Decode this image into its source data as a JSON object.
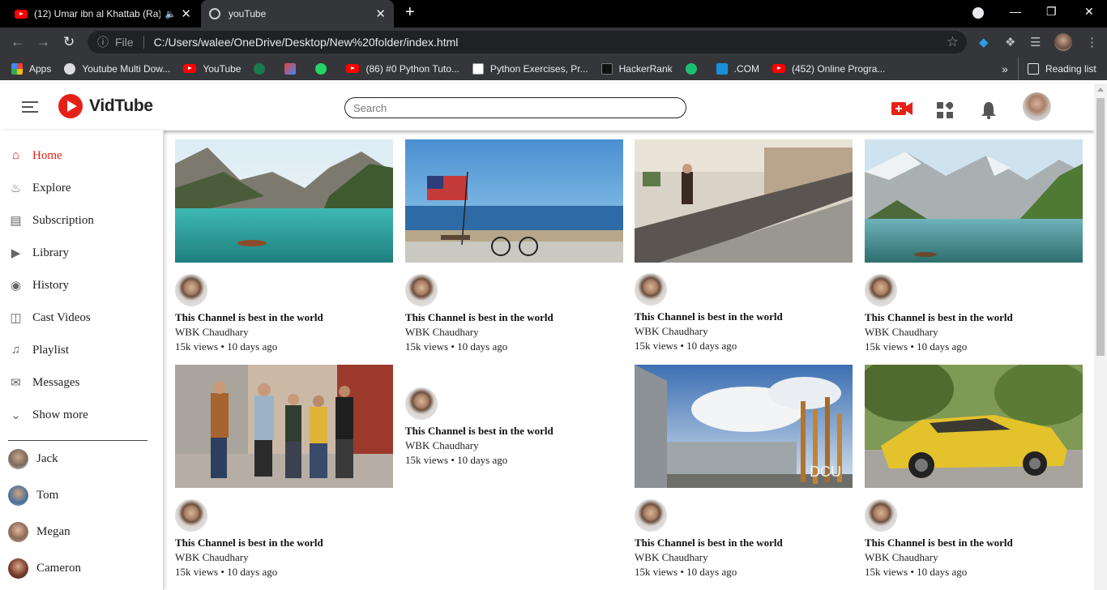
{
  "browser": {
    "tabs": [
      {
        "title": "(12) Umar ibn al Khattab (Ra)",
        "active": false,
        "icon": "youtube-icon"
      },
      {
        "title": "youTube",
        "active": true,
        "icon": "globe-icon"
      }
    ],
    "address": {
      "scheme_label": "File",
      "url": "C:/Users/walee/OneDrive/Desktop/New%20folder/index.html"
    },
    "bookmarks": [
      {
        "label": "Apps",
        "icon": "apps-grid-icon"
      },
      {
        "label": "Youtube Multi Dow...",
        "icon": "globe-icon"
      },
      {
        "label": "YouTube",
        "icon": "youtube-icon"
      },
      {
        "label": "",
        "icon": "drive-icon"
      },
      {
        "label": "",
        "icon": "gmail-icon"
      },
      {
        "label": "",
        "icon": "whatsapp-icon"
      },
      {
        "label": "(86) #0 Python Tuto...",
        "icon": "youtube-icon"
      },
      {
        "label": "Python Exercises, Pr...",
        "icon": "w3-icon"
      },
      {
        "label": "HackerRank",
        "icon": "hackerrank-icon"
      },
      {
        "label": "",
        "icon": "fiverr-icon"
      },
      {
        "label": ".COM",
        "icon": "play-icon"
      },
      {
        "label": "(452) Online Progra...",
        "icon": "youtube-icon"
      }
    ],
    "overflow_label": "»",
    "reading_list_label": "Reading list"
  },
  "header": {
    "logo_text": "VidTube",
    "search_placeholder": "Search",
    "accent_color": "#e62117"
  },
  "sidebar": {
    "items": [
      {
        "label": "Home",
        "icon": "home-icon",
        "active": true
      },
      {
        "label": "Explore",
        "icon": "fire-icon"
      },
      {
        "label": "Subscription",
        "icon": "subscription-icon"
      },
      {
        "label": "Library",
        "icon": "library-icon"
      },
      {
        "label": "History",
        "icon": "history-icon"
      },
      {
        "label": "Cast Videos",
        "icon": "cast-icon"
      },
      {
        "label": "Playlist",
        "icon": "playlist-icon"
      },
      {
        "label": "Messages",
        "icon": "messages-icon"
      },
      {
        "label": "Show more",
        "icon": "chevron-down-icon"
      }
    ],
    "users": [
      {
        "name": "Jack"
      },
      {
        "name": "Tom"
      },
      {
        "name": "Megan"
      },
      {
        "name": "Cameron"
      }
    ]
  },
  "videos": [
    {
      "title": "This Channel is best in the world",
      "channel": "WBK Chaudhary",
      "meta": "15k views • 10 days ago",
      "thumb": "lake-mountains"
    },
    {
      "title": "This Channel is best in the world",
      "channel": "WBK Chaudhary",
      "meta": "15k views • 10 days ago",
      "thumb": "beach-flag"
    },
    {
      "title": "This Channel is best in the world",
      "channel": "WBK Chaudhary",
      "meta": "15k views • 10 days ago",
      "thumb": "mall-escalator"
    },
    {
      "title": "This Channel is best in the world",
      "channel": "WBK Chaudhary",
      "meta": "15k views • 10 days ago",
      "thumb": "alpine-lake"
    },
    {
      "title": "This Channel is best in the world",
      "channel": "WBK Chaudhary",
      "meta": "15k views • 10 days ago",
      "thumb": "friends-walking"
    },
    {
      "title": "This Channel is best in the world",
      "channel": "WBK Chaudhary",
      "meta": "15k views • 10 days ago",
      "thumb": "none"
    },
    {
      "title": "This Channel is best in the world",
      "channel": "WBK Chaudhary",
      "meta": "15k views • 10 days ago",
      "thumb": "dcu-building"
    },
    {
      "title": "This Channel is best in the world",
      "channel": "WBK Chaudhary",
      "meta": "15k views • 10 days ago",
      "thumb": "yellow-car"
    }
  ],
  "thumb_image_text": {
    "dcu-building": "DCU"
  }
}
